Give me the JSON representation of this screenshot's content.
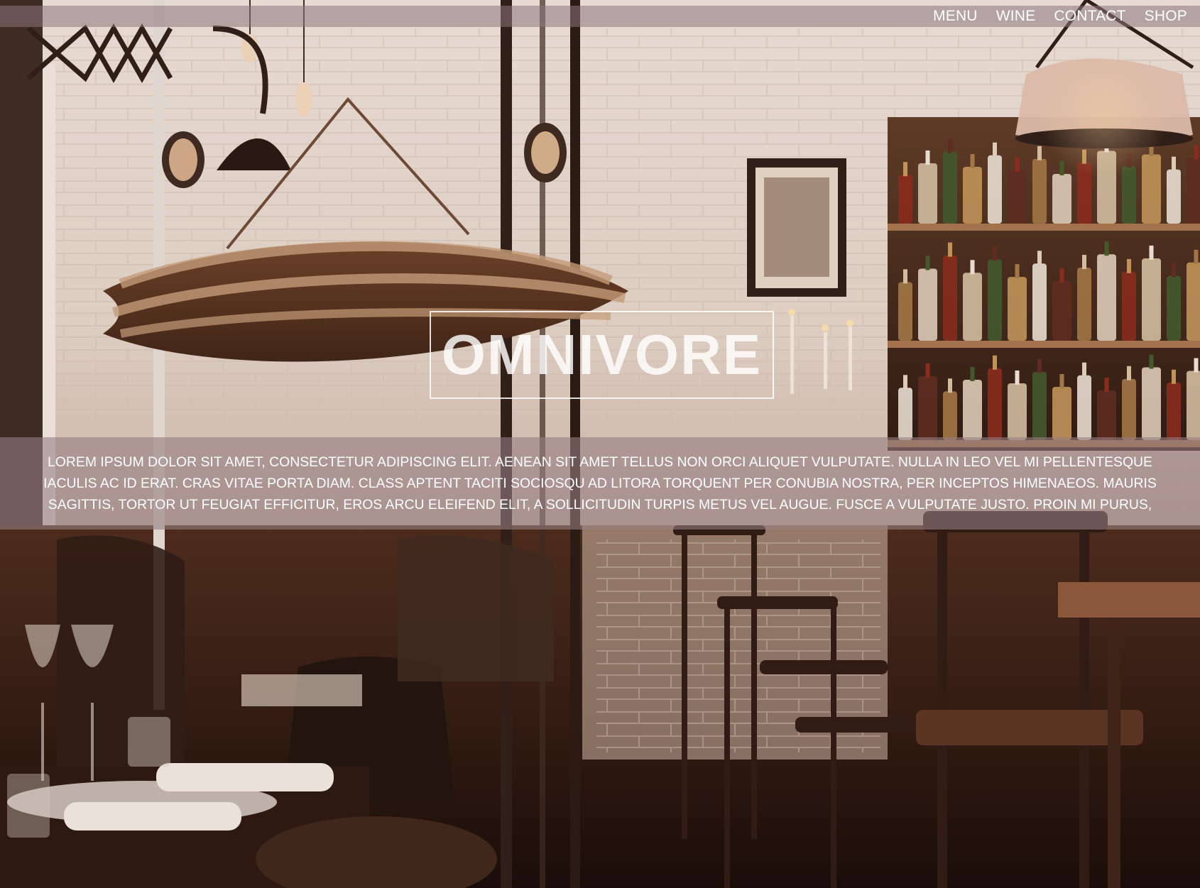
{
  "nav": {
    "items": [
      {
        "label": "MENU"
      },
      {
        "label": "WINE"
      },
      {
        "label": "CONTACT"
      },
      {
        "label": "SHOP"
      }
    ]
  },
  "hero": {
    "logo_text": "OMNIVORE",
    "blurb": "LOREM IPSUM DOLOR SIT AMET, CONSECTETUR ADIPISCING ELIT. AENEAN SIT AMET TELLUS NON ORCI ALIQUET VULPUTATE. NULLA IN LEO VEL MI PELLENTESQUE IACULIS AC ID ERAT. CRAS VITAE PORTA DIAM. CLASS APTENT TACITI SOCIOSQU AD LITORA TORQUENT PER CONUBIA NOSTRA, PER INCEPTOS HIMENAEOS. MAURIS SAGITTIS, TORTOR UT FEUGIAT EFFICITUR, EROS ARCU ELEIFEND ELIT, A SOLLICITUDIN TURPIS METUS VEL AUGUE. FUSCE A VULPUTATE JUSTO. PROIN MI PURUS, PHARETRA EU"
  },
  "background": {
    "description_icon": "restaurant-photo",
    "palette": {
      "wall": "#e9dfd8",
      "wood_dark": "#3a2216",
      "wood_light": "#b78860",
      "floor": "#1c0f0a",
      "lamp_glow": "#f4d2a6"
    }
  }
}
